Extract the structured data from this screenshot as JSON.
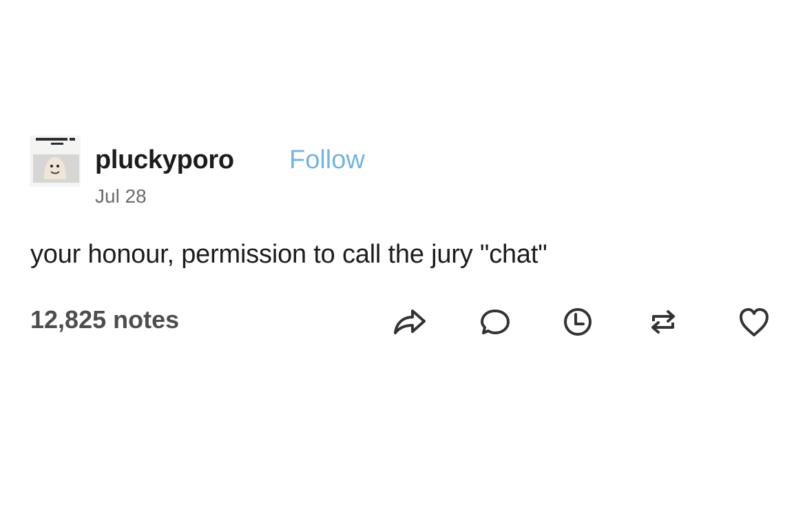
{
  "post": {
    "username": "pluckyporo",
    "follow_label": "Follow",
    "date": "Jul 28",
    "text": "your honour, permission to call the jury \"chat\"",
    "notes": "12,825 notes",
    "avatar": {
      "image": "small laughing-dog meme thumbnail"
    },
    "actions": [
      {
        "name": "share",
        "icon": "share-icon"
      },
      {
        "name": "reply",
        "icon": "speech-bubble-icon"
      },
      {
        "name": "queue",
        "icon": "clock-icon"
      },
      {
        "name": "reblog",
        "icon": "reblog-icon"
      },
      {
        "name": "like",
        "icon": "heart-icon"
      }
    ]
  },
  "colors": {
    "background": "#ffffff",
    "text": "#1d1d1d",
    "follow": "#75b4dd",
    "muted": "#6b6b6b",
    "icon": "#333333"
  }
}
